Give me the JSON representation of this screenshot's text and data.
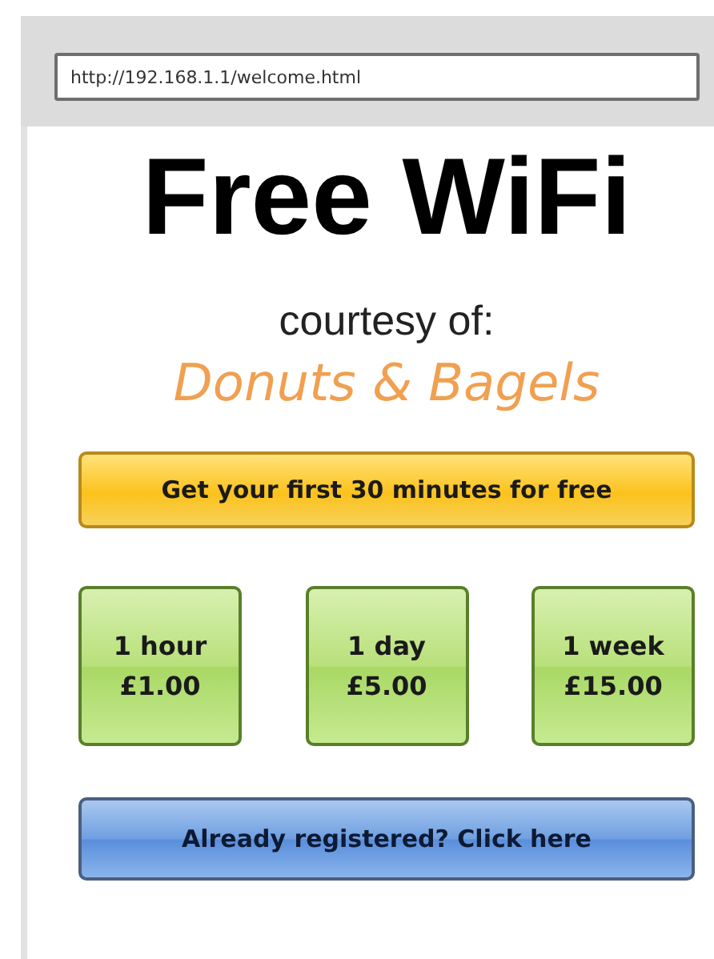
{
  "address_bar": {
    "url": "http://192.168.1.1/welcome.html"
  },
  "title": "Free WiFi",
  "subtitle": "courtesy of:",
  "sponsor": "Donuts & Bagels",
  "free_offer_button": "Get your first 30 minutes for free",
  "plans": [
    {
      "duration": "1 hour",
      "price": "£1.00"
    },
    {
      "duration": "1 day",
      "price": "£5.00"
    },
    {
      "duration": "1 week",
      "price": "£15.00"
    }
  ],
  "login_button": "Already registered? Click here"
}
